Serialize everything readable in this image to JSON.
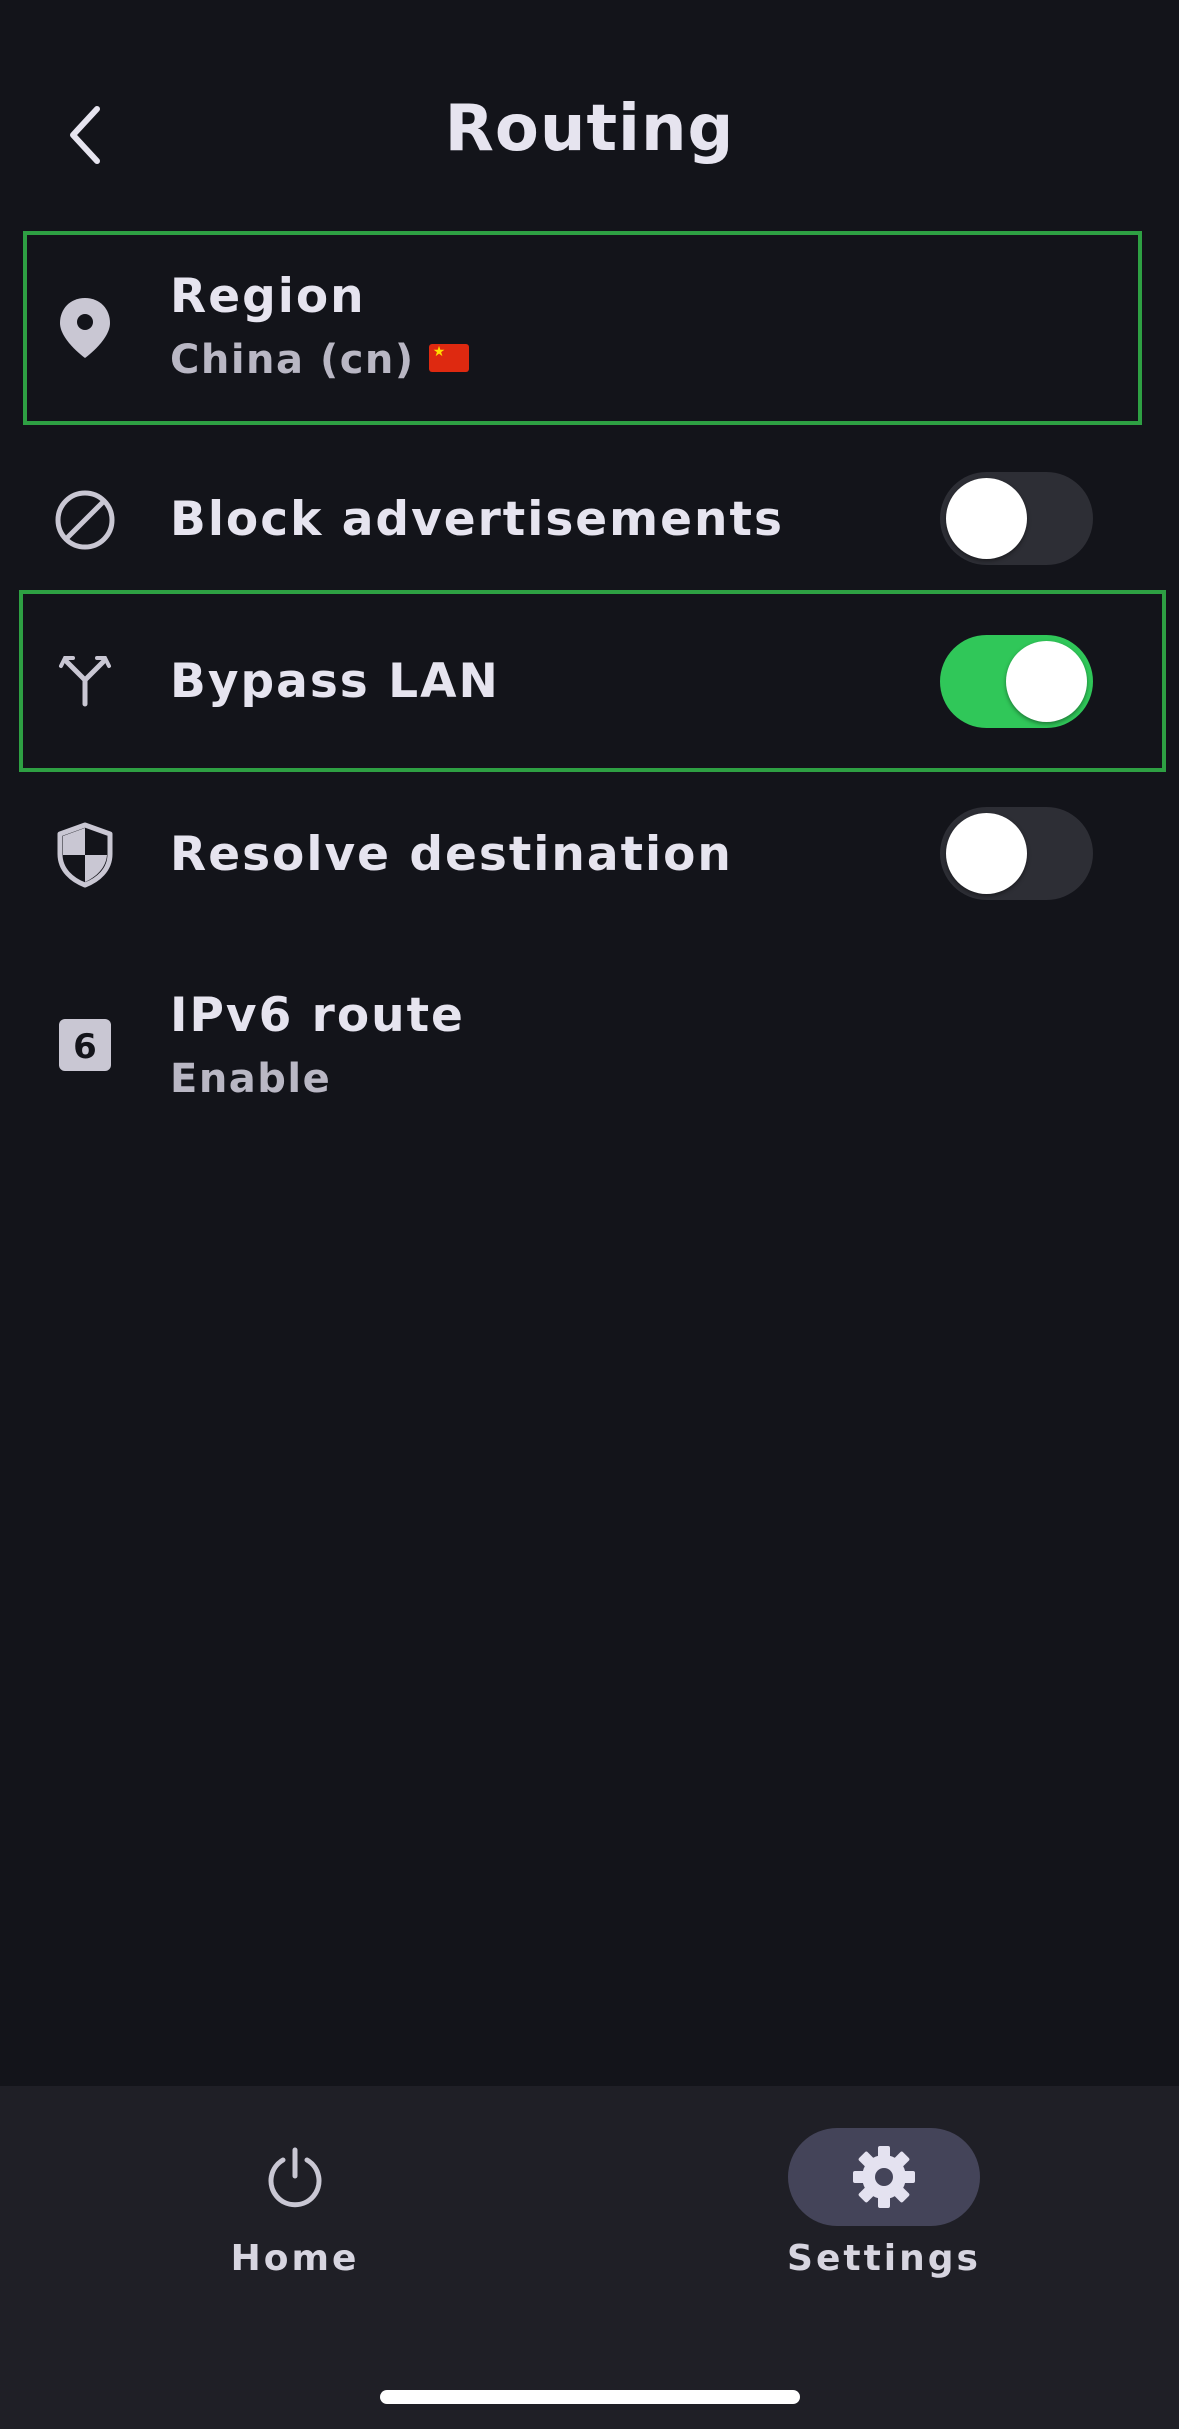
{
  "header": {
    "title": "Routing",
    "back_icon": "chevron-left-icon"
  },
  "settings": {
    "region": {
      "label": "Region",
      "value": "China (cn)",
      "flag": "🇨🇳",
      "icon": "location-pin-icon"
    },
    "block_ads": {
      "label": "Block advertisements",
      "enabled": false,
      "icon": "block-icon"
    },
    "bypass_lan": {
      "label": "Bypass LAN",
      "enabled": true,
      "icon": "split-route-icon"
    },
    "resolve_destination": {
      "label": "Resolve destination",
      "enabled": false,
      "icon": "shield-icon"
    },
    "ipv6_route": {
      "label": "IPv6 route",
      "value": "Enable",
      "icon": "ipv6-icon"
    }
  },
  "bottom_nav": {
    "home": {
      "label": "Home",
      "icon": "power-icon"
    },
    "settings": {
      "label": "Settings",
      "icon": "gear-icon",
      "active": true
    }
  },
  "colors": {
    "background": "#13141a",
    "accent_green": "#30c759",
    "highlight_border": "#2ea043",
    "nav_bar": "#1f1f26",
    "nav_active_pill": "#444459"
  }
}
